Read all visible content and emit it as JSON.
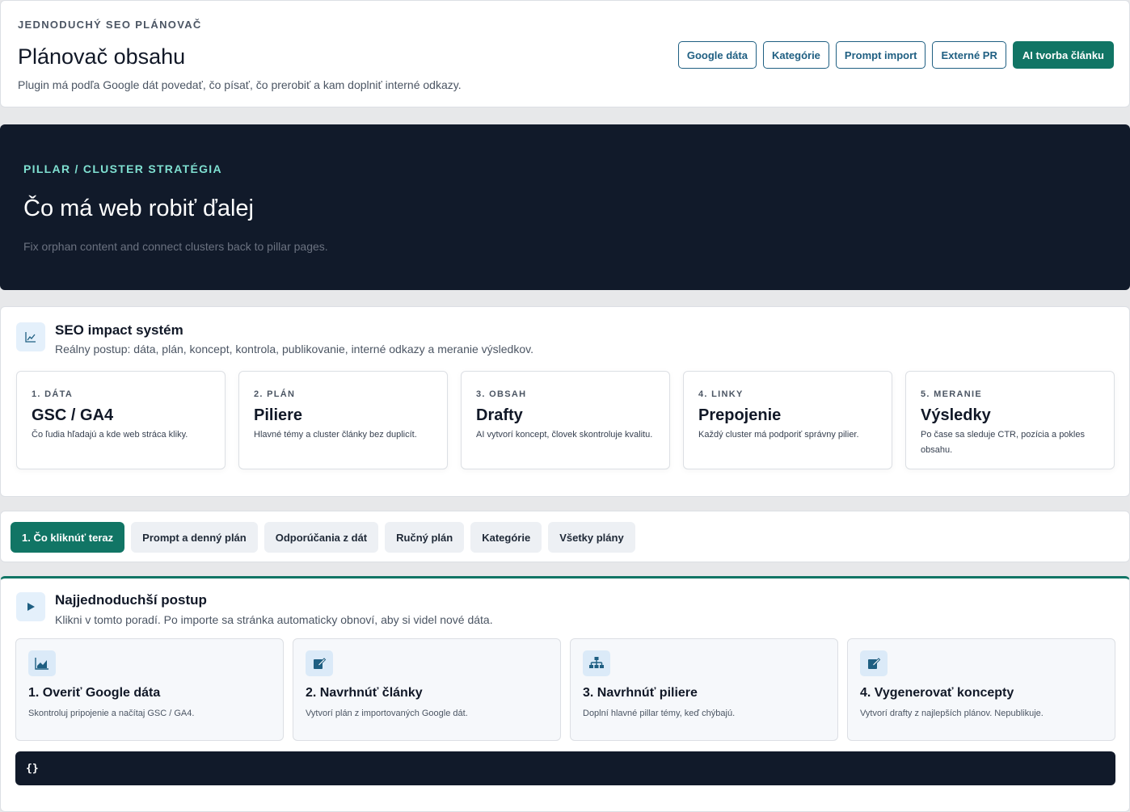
{
  "header": {
    "eyebrow": "JEDNODUCHÝ SEO PLÁNOVAČ",
    "title": "Plánovač obsahu",
    "subtitle": "Plugin má podľa Google dát povedať, čo písať, čo prerobiť a kam doplniť interné odkazy.",
    "buttons": [
      "Google dáta",
      "Kategórie",
      "Prompt import",
      "Externé PR",
      "AI tvorba článku"
    ]
  },
  "hero": {
    "eyebrow": "PILLAR / CLUSTER STRATÉGIA",
    "title": "Čo má web robiť ďalej",
    "text": "Fix orphan content and connect clusters back to pillar pages."
  },
  "impact": {
    "icon": "chart-line-icon",
    "title": "SEO impact systém",
    "subtitle": "Reálny postup: dáta, plán, koncept, kontrola, publikovanie, interné odkazy a meranie výsledkov.",
    "steps": [
      {
        "kicker": "1. DÁTA",
        "title": "GSC / GA4",
        "text": "Čo ľudia hľadajú a kde web stráca kliky."
      },
      {
        "kicker": "2. PLÁN",
        "title": "Piliere",
        "text": "Hlavné témy a cluster články bez duplicít."
      },
      {
        "kicker": "3. OBSAH",
        "title": "Drafty",
        "text": "AI vytvorí koncept, človek skontroluje kvalitu."
      },
      {
        "kicker": "4. LINKY",
        "title": "Prepojenie",
        "text": "Každý cluster má podporiť správny pilier."
      },
      {
        "kicker": "5. MERANIE",
        "title": "Výsledky",
        "text": "Po čase sa sleduje CTR, pozícia a pokles obsahu."
      }
    ]
  },
  "tabs": [
    "1. Čo kliknúť teraz",
    "Prompt a denný plán",
    "Odporúčania z dát",
    "Ručný plán",
    "Kategórie",
    "Všetky plány"
  ],
  "flow": {
    "icon": "play-icon",
    "title": "Najjednoduchší postup",
    "subtitle": "Klikni v tomto poradí. Po importe sa stránka automaticky obnoví, aby si videl nové dáta.",
    "actions": [
      {
        "icon": "area-chart-icon",
        "title": "1. Overiť Google dáta",
        "text": "Skontroluj pripojenie a načítaj GSC / GA4."
      },
      {
        "icon": "edit-icon",
        "title": "2. Navrhnúť články",
        "text": "Vytvorí plán z importovaných Google dát."
      },
      {
        "icon": "sitemap-icon",
        "title": "3. Navrhnúť piliere",
        "text": "Doplní hlavné pillar témy, keď chýbajú."
      },
      {
        "icon": "edit-icon",
        "title": "4. Vygenerovať koncepty",
        "text": "Vytvorí drafty z najlepších plánov. Nepublikuje."
      }
    ],
    "console": "{}"
  },
  "colors": {
    "accent": "#117565",
    "link": "#1f5f82",
    "dark": "#111a2a",
    "hero_eyebrow": "#7fe0d1"
  }
}
